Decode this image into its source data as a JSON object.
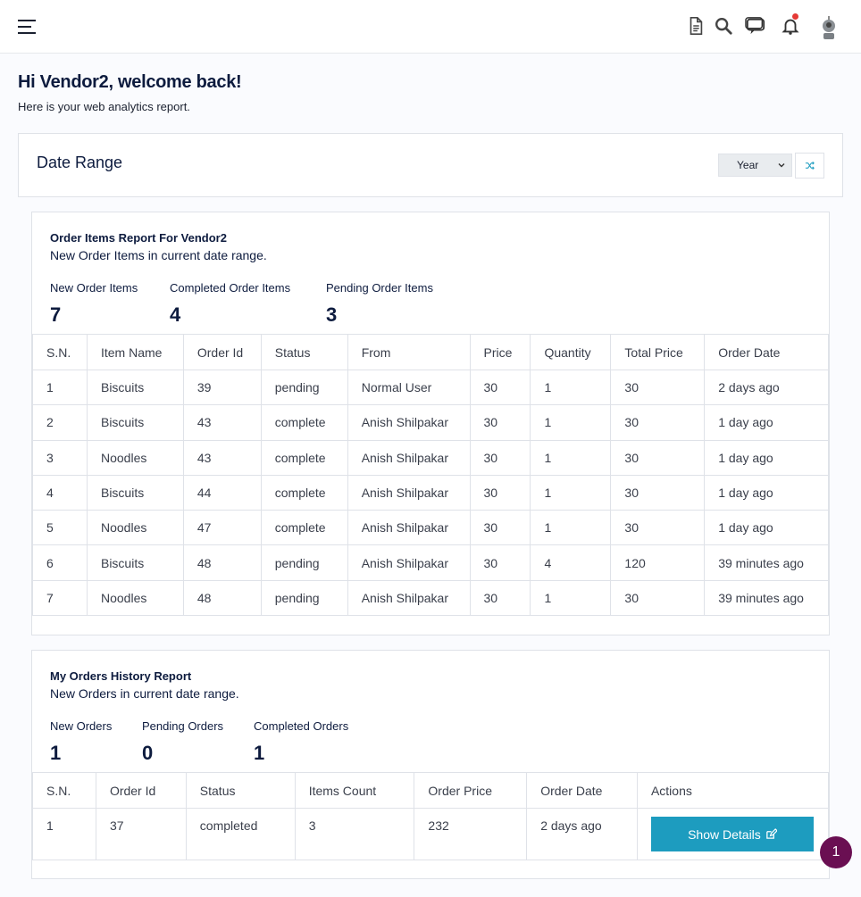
{
  "header": {
    "icons": [
      "menu-icon",
      "document-icon",
      "search-icon",
      "chat-icon",
      "bell-icon",
      "avatar"
    ]
  },
  "welcome": {
    "title": "Hi Vendor2, welcome back!",
    "subtitle": "Here is your web analytics report."
  },
  "date_range": {
    "title": "Date Range",
    "selected": "Year"
  },
  "order_items": {
    "title": "Order Items Report For Vendor2",
    "subtitle": "New Order Items in current date range.",
    "stats": [
      {
        "label": "New Order Items",
        "value": "7"
      },
      {
        "label": "Completed Order Items",
        "value": "4"
      },
      {
        "label": "Pending Order Items",
        "value": "3"
      }
    ],
    "columns": [
      "S.N.",
      "Item Name",
      "Order Id",
      "Status",
      "From",
      "Price",
      "Quantity",
      "Total Price",
      "Order Date"
    ],
    "rows": [
      [
        "1",
        "Biscuits",
        "39",
        "pending",
        "Normal User",
        "30",
        "1",
        "30",
        "2 days ago"
      ],
      [
        "2",
        "Biscuits",
        "43",
        "complete",
        "Anish Shilpakar",
        "30",
        "1",
        "30",
        "1 day ago"
      ],
      [
        "3",
        "Noodles",
        "43",
        "complete",
        "Anish Shilpakar",
        "30",
        "1",
        "30",
        "1 day ago"
      ],
      [
        "4",
        "Biscuits",
        "44",
        "complete",
        "Anish Shilpakar",
        "30",
        "1",
        "30",
        "1 day ago"
      ],
      [
        "5",
        "Noodles",
        "47",
        "complete",
        "Anish Shilpakar",
        "30",
        "1",
        "30",
        "1 day ago"
      ],
      [
        "6",
        "Biscuits",
        "48",
        "pending",
        "Anish Shilpakar",
        "30",
        "4",
        "120",
        "39 minutes ago"
      ],
      [
        "7",
        "Noodles",
        "48",
        "pending",
        "Anish Shilpakar",
        "30",
        "1",
        "30",
        "39 minutes ago"
      ]
    ]
  },
  "orders_history": {
    "title": "My Orders History Report",
    "subtitle": "New Orders in current date range.",
    "stats": [
      {
        "label": "New Orders",
        "value": "1"
      },
      {
        "label": "Pending Orders",
        "value": "0"
      },
      {
        "label": "Completed Orders",
        "value": "1"
      }
    ],
    "columns": [
      "S.N.",
      "Order Id",
      "Status",
      "Items Count",
      "Order Price",
      "Order Date",
      "Actions"
    ],
    "rows": [
      [
        "1",
        "37",
        "completed",
        "3",
        "232",
        "2 days ago"
      ]
    ],
    "action_label": "Show Details"
  },
  "fab": {
    "label": "1"
  },
  "colors": {
    "accent": "#1d9cbf",
    "fab": "#6a0f52",
    "notification": "#e53935",
    "heading": "#0d1b3e"
  }
}
